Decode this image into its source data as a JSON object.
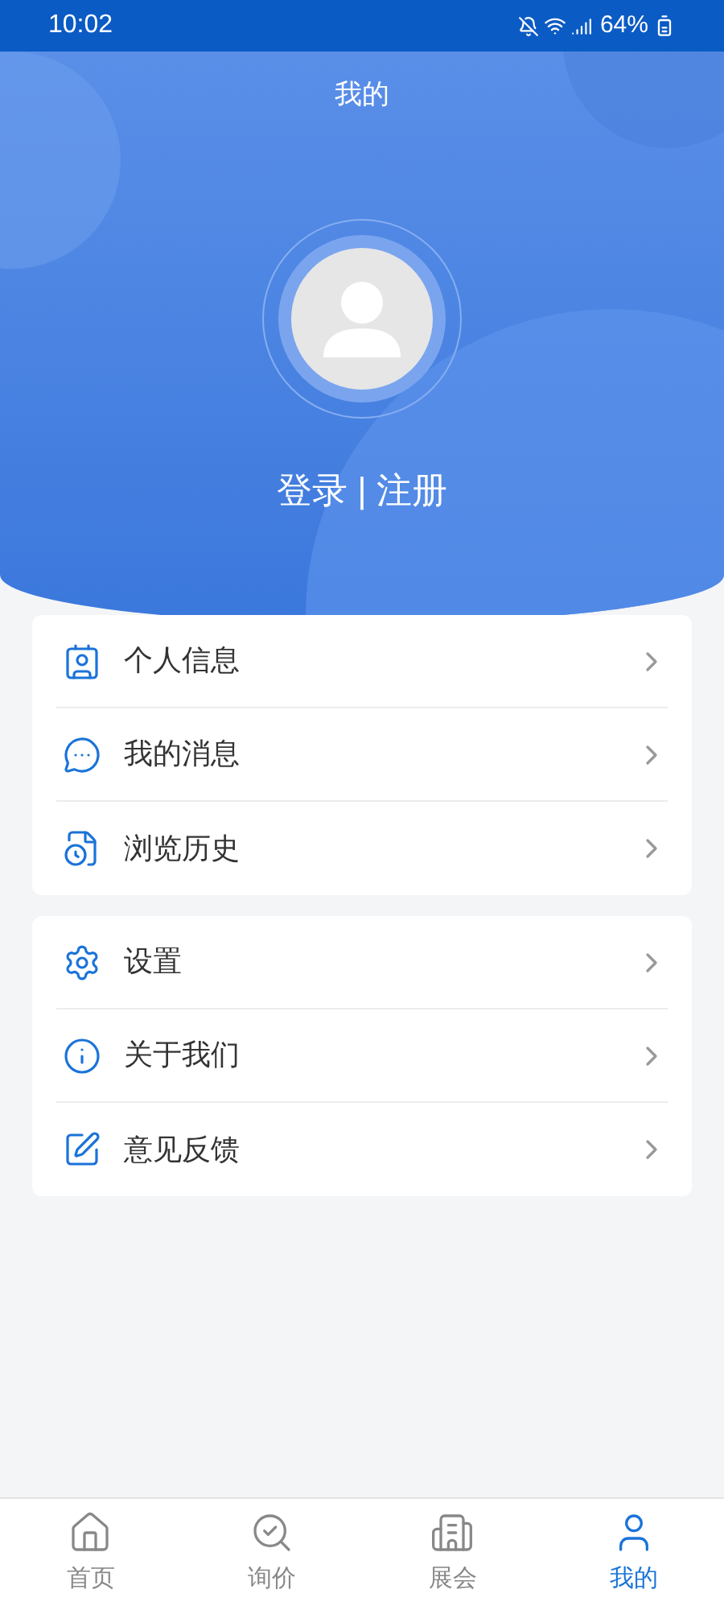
{
  "status_bar": {
    "time": "10:02",
    "battery": "64%"
  },
  "header": {
    "title": "我的",
    "login": "登录",
    "separator": "|",
    "register": "注册"
  },
  "menu_groups": [
    {
      "items": [
        {
          "label": "个人信息"
        },
        {
          "label": "我的消息"
        },
        {
          "label": "浏览历史"
        }
      ]
    },
    {
      "items": [
        {
          "label": "设置"
        },
        {
          "label": "关于我们"
        },
        {
          "label": "意见反馈"
        }
      ]
    }
  ],
  "tab_bar": [
    {
      "label": "首页",
      "selected": false
    },
    {
      "label": "询价",
      "selected": false
    },
    {
      "label": "展会",
      "selected": false
    },
    {
      "label": "我的",
      "selected": true
    }
  ]
}
